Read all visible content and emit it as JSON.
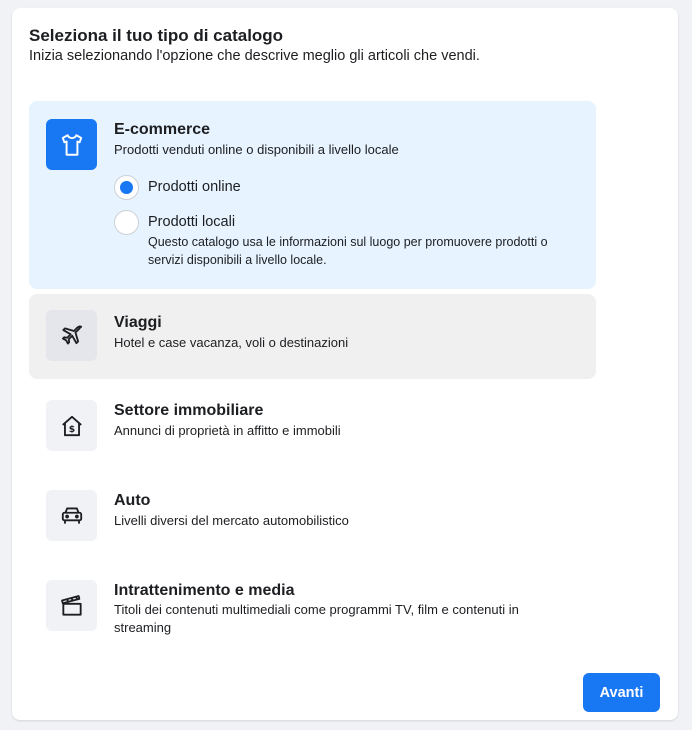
{
  "header": {
    "title": "Seleziona il tuo tipo di catalogo",
    "subtitle": "Inizia selezionando l'opzione che descrive meglio gli articoli che vendi."
  },
  "options": [
    {
      "icon": "tshirt-icon",
      "title": "E-commerce",
      "description": "Prodotti venduti online o disponibili a livello locale",
      "selected": true,
      "sub_options": [
        {
          "label": "Prodotti online",
          "checked": true
        },
        {
          "label": "Prodotti locali",
          "checked": false,
          "description": "Questo catalogo usa le informazioni sul luogo per promuovere prodotti o servizi disponibili a livello locale."
        }
      ]
    },
    {
      "icon": "airplane-icon",
      "title": "Viaggi",
      "description": "Hotel e case vacanza, voli o destinazioni",
      "selected": false
    },
    {
      "icon": "house-dollar-icon",
      "title": "Settore immobiliare",
      "description": "Annunci di proprietà in affitto e immobili",
      "selected": false
    },
    {
      "icon": "car-icon",
      "title": "Auto",
      "description": "Livelli diversi del mercato automobilistico",
      "selected": false
    },
    {
      "icon": "clapperboard-icon",
      "title": "Intrattenimento e media",
      "description": "Titoli dei contenuti multimediali come programmi TV, film e contenuti in streaming",
      "selected": false
    }
  ],
  "footer": {
    "next_label": "Avanti"
  },
  "colors": {
    "accent": "#1877f2",
    "selected_bg": "#e7f3ff",
    "hover_bg": "#f0f0f0"
  }
}
